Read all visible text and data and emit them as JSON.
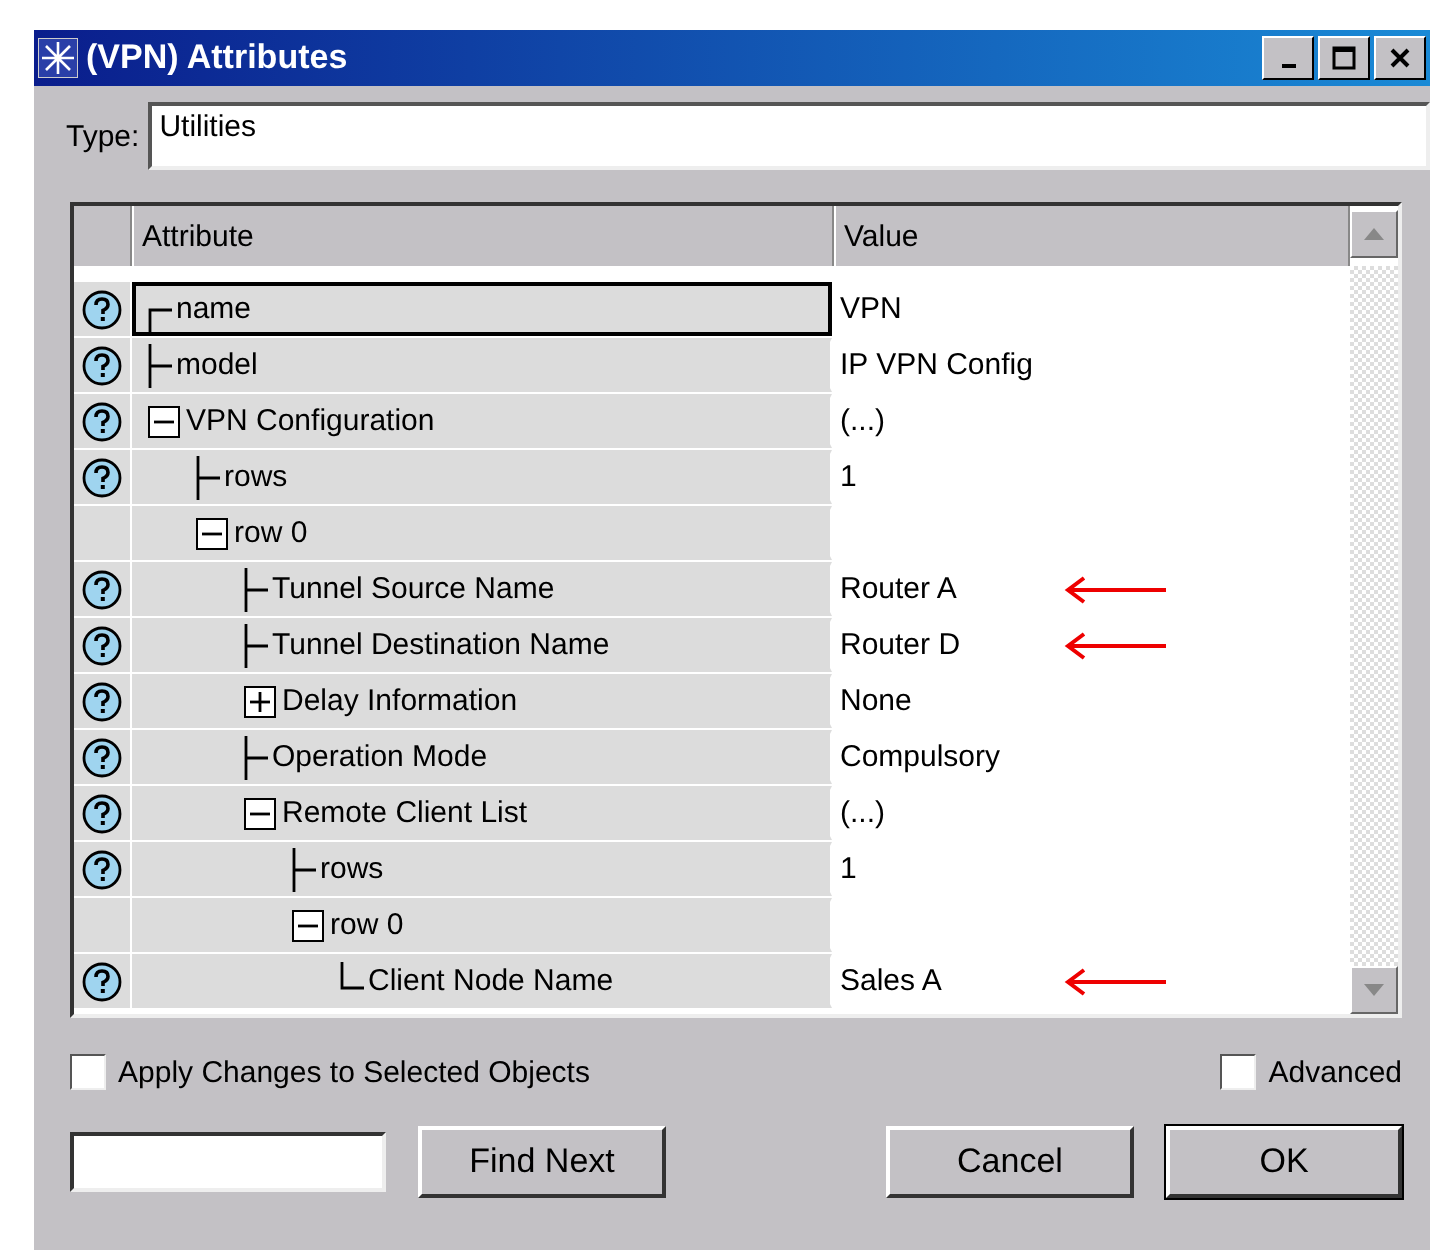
{
  "window": {
    "title": "(VPN) Attributes"
  },
  "type_field": {
    "label": "Type:",
    "value": "Utilities"
  },
  "table": {
    "columns": [
      "Attribute",
      "Value"
    ],
    "rows": [
      {
        "name": "name",
        "value": "VPN",
        "help": true,
        "selected": true,
        "arrow": false
      },
      {
        "name": "model",
        "value": "IP VPN Config",
        "help": true,
        "selected": false,
        "arrow": false
      },
      {
        "name": "VPN Configuration",
        "value": "(...)",
        "help": true,
        "selected": false,
        "expanded": true,
        "arrow": false,
        "children": [
          {
            "name": "rows",
            "value": "1",
            "help": true,
            "selected": false,
            "arrow": false
          },
          {
            "name": "row 0",
            "help": false,
            "selected": false,
            "expanded": true,
            "arrow": false,
            "children": [
              {
                "name": "Tunnel Source Name",
                "value": "Router A",
                "help": true,
                "selected": false,
                "arrow": true
              },
              {
                "name": "Tunnel Destination Name",
                "value": "Router D",
                "help": true,
                "selected": false,
                "arrow": true
              },
              {
                "name": "Delay Information",
                "value": "None",
                "help": true,
                "selected": false,
                "expanded": false,
                "arrow": false
              },
              {
                "name": "Operation Mode",
                "value": "Compulsory",
                "help": true,
                "selected": false,
                "arrow": false
              },
              {
                "name": "Remote Client List",
                "value": "(...)",
                "help": true,
                "selected": false,
                "expanded": true,
                "arrow": false,
                "children": [
                  {
                    "name": "rows",
                    "value": "1",
                    "help": true,
                    "selected": false,
                    "arrow": false
                  },
                  {
                    "name": "row 0",
                    "help": false,
                    "selected": false,
                    "expanded": true,
                    "arrow": false,
                    "children": [
                      {
                        "name": "Client Node Name",
                        "value": "Sales A",
                        "help": true,
                        "selected": false,
                        "arrow": true
                      }
                    ]
                  }
                ]
              }
            ]
          }
        ]
      }
    ]
  },
  "apply_changes": {
    "label": "Apply Changes to Selected Objects",
    "checked": false
  },
  "advanced": {
    "label": "Advanced",
    "checked": false
  },
  "buttons": [
    {
      "label": "Find Next",
      "kind": "find"
    },
    {
      "label": "Cancel",
      "kind": "cancel"
    },
    {
      "label": "OK",
      "kind": "ok"
    }
  ]
}
